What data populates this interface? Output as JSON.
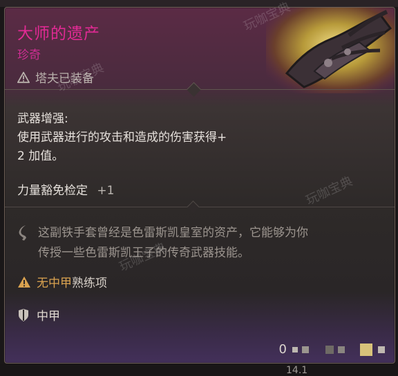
{
  "item": {
    "name": "大师的遗产",
    "rarity": "珍奇",
    "equipped_by": "塔夫已装备",
    "enhancement_title": "武器增强:",
    "enhancement_desc_line1": "使用武器进行的攻击和造成的伤害获得+",
    "enhancement_desc_line2": "2 加值。",
    "save_label": "力量豁免检定",
    "save_bonus": "+1",
    "lore_line1": "这副铁手套曾经是色雷斯凯皇室的资产，它能够为你",
    "lore_line2": "传授一些色雷斯凯王子的传奇武器技能。",
    "proficiency_part1": "无中甲",
    "proficiency_part2": "熟练项",
    "armor_type": "中甲",
    "value": "0"
  },
  "watermarks": [
    "玩咖宝典",
    "玩咖宝典",
    "玩咖宝典",
    "玩咖宝典"
  ],
  "background": {
    "bottom_text": "14.1"
  },
  "colors": {
    "rarity": "#cf2d93",
    "title": "#e12a94",
    "warning_orange": "#d9a24f",
    "grey_text": "#9c958f"
  },
  "icons": {
    "equipped": "warning-triangle-icon",
    "lore": "quill-icon",
    "proficiency": "warning-triangle-icon",
    "armor": "shield-icon"
  }
}
